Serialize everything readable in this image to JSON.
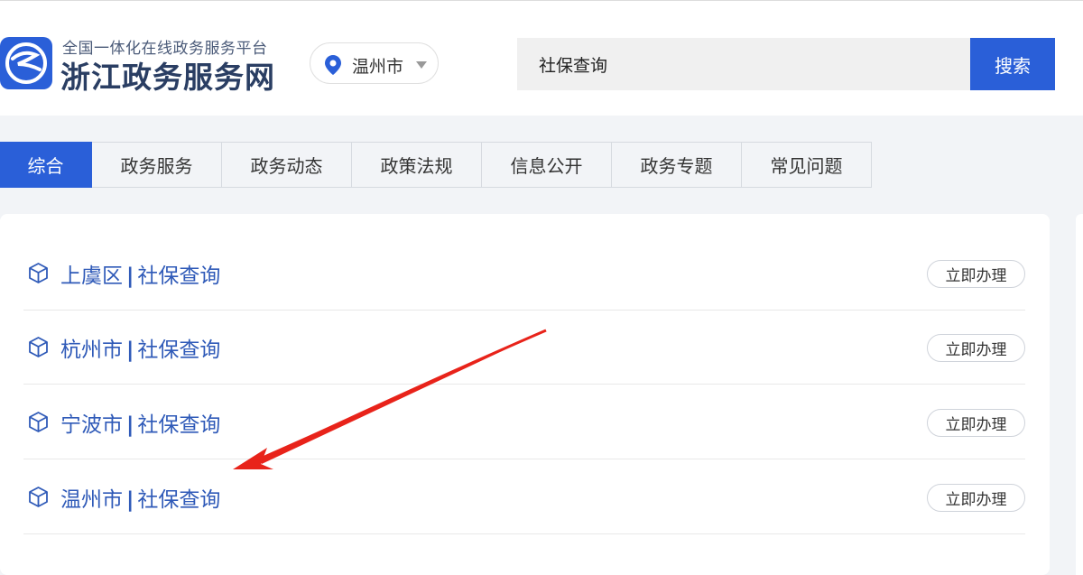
{
  "header": {
    "logo_icon": "zhejiang-logo-icon",
    "subtitle": "全国一体化在线政务服务平台",
    "title": "浙江政务服务网",
    "city": "温州市",
    "search_value": "社保查询",
    "search_button": "搜索"
  },
  "tabs": [
    {
      "label": "综合",
      "active": true
    },
    {
      "label": "政务服务",
      "active": false
    },
    {
      "label": "政务动态",
      "active": false
    },
    {
      "label": "政策法规",
      "active": false
    },
    {
      "label": "信息公开",
      "active": false
    },
    {
      "label": "政务专题",
      "active": false
    },
    {
      "label": "常见问题",
      "active": false
    }
  ],
  "results": [
    {
      "region": "上虞区",
      "separator": "|",
      "service": "社保查询",
      "action": "立即办理"
    },
    {
      "region": "杭州市",
      "separator": "|",
      "service": "社保查询",
      "action": "立即办理"
    },
    {
      "region": "宁波市",
      "separator": "|",
      "service": "社保查询",
      "action": "立即办理"
    },
    {
      "region": "温州市",
      "separator": "|",
      "service": "社保查询",
      "action": "立即办理"
    }
  ],
  "colors": {
    "accent": "#2a5fd8",
    "link": "#2f5ab8",
    "annotation_arrow": "#e8231a"
  }
}
